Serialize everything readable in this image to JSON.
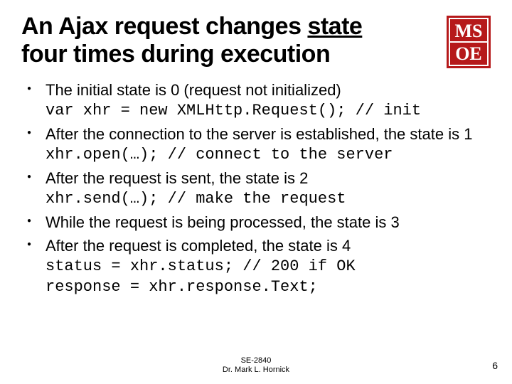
{
  "title": {
    "line1_pre": "An Ajax request changes ",
    "line1_underlined": "state",
    "line2": "four times during execution"
  },
  "bullets": [
    {
      "text": "The initial state is 0 (request not initialized)",
      "code": "var xhr = new XMLHttp.Request(); // init"
    },
    {
      "text": "After the connection to the server is established, the state is 1",
      "code": "xhr.open(…); // connect to the server"
    },
    {
      "text": "After the request is sent, the state is 2",
      "code": "xhr.send(…); // make the request"
    },
    {
      "text": "While the request is being processed, the state is 3",
      "code": ""
    },
    {
      "text": "After the request is completed, the state is 4",
      "code": "status = xhr.status; // 200 if OK\nresponse = xhr.response.Text;"
    }
  ],
  "footer": {
    "course": "SE-2840",
    "author": "Dr. Mark L. Hornick"
  },
  "page_number": "6",
  "logo": {
    "text_top": "MS",
    "text_bottom": "OE"
  }
}
